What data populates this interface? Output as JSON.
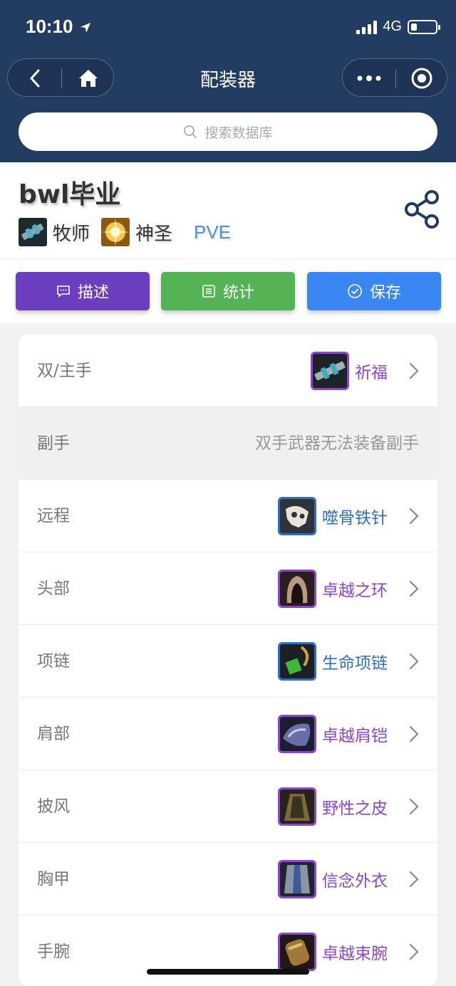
{
  "status": {
    "time": "10:10",
    "network": "4G"
  },
  "nav": {
    "title": "配装器"
  },
  "search": {
    "placeholder": "搜索数据库"
  },
  "build": {
    "name": "bwl毕业",
    "class_label": "牧师",
    "spec_label": "神圣",
    "mode_label": "PVE"
  },
  "actions": {
    "describe": "描述",
    "stats": "统计",
    "save": "保存",
    "colors": {
      "describe": "#6b3ec0",
      "stats": "#55b255",
      "save": "#3a86f3"
    }
  },
  "colors": {
    "epic": "#8e44ce",
    "rare": "#2f6fbf"
  },
  "slots": [
    {
      "slot": "双/主手",
      "item": "祈福",
      "quality": "epic",
      "icon": "staff-icon"
    },
    {
      "slot": "副手",
      "disabled_text": "双手武器无法装备副手"
    },
    {
      "slot": "远程",
      "item": "噬骨铁针",
      "quality": "rare",
      "icon": "skull-wand-icon"
    },
    {
      "slot": "头部",
      "item": "卓越之环",
      "quality": "epic",
      "icon": "hood-icon"
    },
    {
      "slot": "项链",
      "item": "生命项链",
      "quality": "rare",
      "icon": "necklace-icon"
    },
    {
      "slot": "肩部",
      "item": "卓越肩铠",
      "quality": "epic",
      "icon": "shoulder-icon"
    },
    {
      "slot": "披风",
      "item": "野性之皮",
      "quality": "epic",
      "icon": "cloak-icon"
    },
    {
      "slot": "胸甲",
      "item": "信念外衣",
      "quality": "epic",
      "icon": "robe-icon"
    },
    {
      "slot": "手腕",
      "item": "卓越束腕",
      "quality": "epic",
      "icon": "bracer-icon"
    }
  ]
}
